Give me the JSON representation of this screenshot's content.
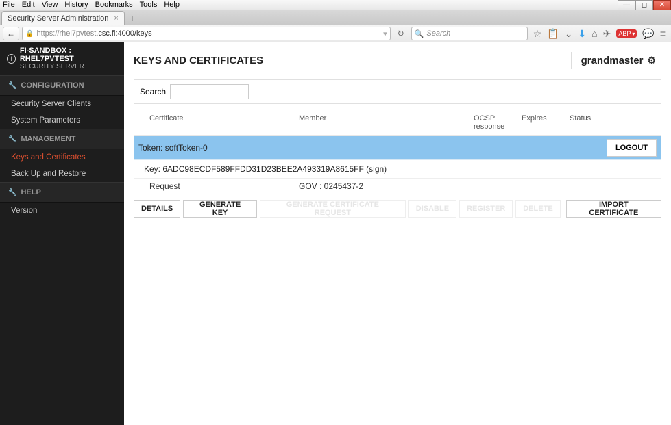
{
  "menubar": {
    "items": [
      "File",
      "Edit",
      "View",
      "History",
      "Bookmarks",
      "Tools",
      "Help"
    ]
  },
  "tab": {
    "title": "Security Server Administration"
  },
  "url": {
    "prefix": "https://rhel7pvtest",
    "rest": ".csc.fi:4000/keys"
  },
  "search_placeholder": "Search",
  "sidebar": {
    "server_name": "FI-SANDBOX : RHEL7PVTEST",
    "server_sub": "SECURITY SERVER",
    "sections": [
      {
        "title": "CONFIGURATION",
        "items": [
          "Security Server Clients",
          "System Parameters"
        ]
      },
      {
        "title": "MANAGEMENT",
        "items": [
          "Keys and Certificates",
          "Back Up and Restore"
        ],
        "active_index": 0
      },
      {
        "title": "HELP",
        "items": [
          "Version"
        ]
      }
    ]
  },
  "page": {
    "title": "KEYS AND CERTIFICATES",
    "user": "grandmaster",
    "search_label": "Search",
    "columns": {
      "cert": "Certificate",
      "member": "Member",
      "ocsp": "OCSP response",
      "expires": "Expires",
      "status": "Status"
    },
    "token_label": "Token: softToken-0",
    "logout_button": "LOGOUT",
    "key_label": "Key: 6ADC98ECDF589FFDD31D23BEE2A493319A8615FF (sign)",
    "request_label": "Request",
    "request_member": "GOV : 0245437-2",
    "buttons": {
      "details": "DETAILS",
      "genkey": "GENERATE KEY",
      "gencsr": "GENERATE CERTIFICATE REQUEST",
      "disable": "DISABLE",
      "register": "REGISTER",
      "delete": "DELETE",
      "import": "IMPORT CERTIFICATE"
    }
  }
}
